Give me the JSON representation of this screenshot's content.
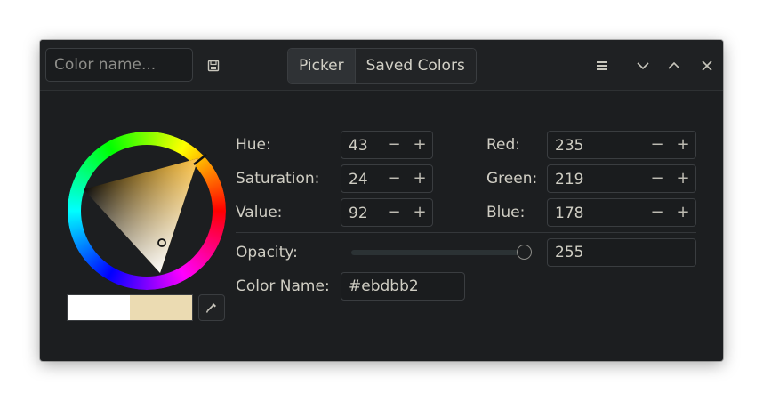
{
  "header": {
    "name_placeholder": "Color name...",
    "save_icon": "save-icon",
    "tabs": [
      {
        "label": "Picker",
        "active": true
      },
      {
        "label": "Saved Colors",
        "active": false
      }
    ],
    "menu_icon": "hamburger-menu-icon",
    "minimize_icon": "chevron-down-icon",
    "maximize_icon": "chevron-up-icon",
    "close_icon": "close-icon"
  },
  "picker": {
    "old_color": "#ffffff",
    "new_color": "#ebdbb2",
    "eyedropper_icon": "eyedropper-icon"
  },
  "fields": {
    "hue": {
      "label": "Hue:",
      "value": "43"
    },
    "saturation": {
      "label": "Saturation:",
      "value": "24"
    },
    "value": {
      "label": "Value:",
      "value": "92"
    },
    "red": {
      "label": "Red:",
      "value": "235"
    },
    "green": {
      "label": "Green:",
      "value": "219"
    },
    "blue": {
      "label": "Blue:",
      "value": "178"
    },
    "opacity": {
      "label": "Opacity:",
      "value": "255",
      "fraction": 1.0
    },
    "color_name": {
      "label": "Color Name:",
      "value": "#ebdbb2"
    }
  },
  "stepper": {
    "minus": "−",
    "plus": "+"
  },
  "colors": {
    "window_bg": "#1c1e20",
    "text": "#cfcdc3",
    "selected": "#ebdbb2"
  }
}
